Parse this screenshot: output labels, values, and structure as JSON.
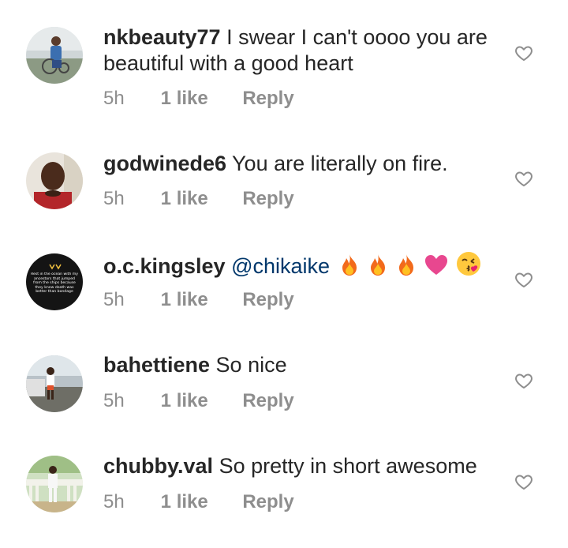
{
  "comments": [
    {
      "username": "nkbeauty77",
      "text": "I swear I can't oooo you are beautiful with a good heart",
      "time": "5h",
      "likes": "1 like",
      "reply": "Reply",
      "avatar_icon": "avatar-person-wheelchair"
    },
    {
      "username": "godwinede6",
      "text": "You are literally on fire.",
      "time": "5h",
      "likes": "1 like",
      "reply": "Reply",
      "avatar_icon": "avatar-man-portrait"
    },
    {
      "username": "o.c.kingsley",
      "mention": "@chikaike",
      "emojis": [
        "fire-emoji",
        "fire-emoji",
        "fire-emoji",
        "pink-heart-emoji",
        "kissing-face-emoji"
      ],
      "time": "5h",
      "likes": "1 like",
      "reply": "Reply",
      "avatar_icon": "avatar-text-quote",
      "avatar_text": "Rest in the ocean with my ancestors that jumped from the ships because they knew death was better than bondage"
    },
    {
      "username": "bahettiene",
      "text": "So nice",
      "time": "5h",
      "likes": "1 like",
      "reply": "Reply",
      "avatar_icon": "avatar-person-street"
    },
    {
      "username": "chubby.val",
      "text": "So pretty in short awesome",
      "time": "5h",
      "likes": "1 like",
      "reply": "Reply",
      "avatar_icon": "avatar-person-balcony"
    }
  ],
  "colors": {
    "username": "#262626",
    "meta": "#8e8e8e",
    "mention": "#00376b",
    "heart_outline": "#8e8e8e"
  }
}
